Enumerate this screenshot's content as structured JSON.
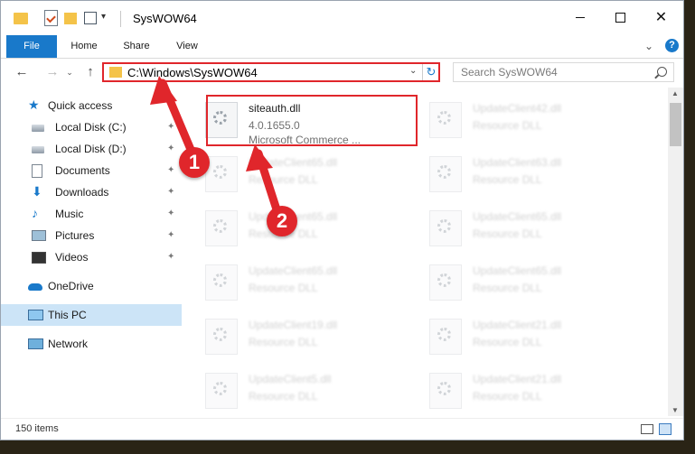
{
  "window": {
    "title": "SysWOW64",
    "controls": {
      "minimize": "—",
      "maximize": "☐",
      "close": "✕"
    }
  },
  "ribbon": {
    "tabs": [
      "File",
      "Home",
      "Share",
      "View"
    ],
    "help_label": "?",
    "chevron": "⌄"
  },
  "navigation": {
    "back": "←",
    "forward": "→",
    "recent": "⌄",
    "up": "↑",
    "address": "C:\\Windows\\SysWOW64",
    "refresh": "↻",
    "search_placeholder": "Search SysWOW64"
  },
  "sidebar": {
    "items": [
      {
        "label": "Quick access",
        "icon": "star-icon",
        "pinned": false
      },
      {
        "label": "Local Disk (C:)",
        "icon": "drive-icon",
        "pinned": true
      },
      {
        "label": "Local Disk (D:)",
        "icon": "drive-icon",
        "pinned": true
      },
      {
        "label": "Documents",
        "icon": "documents-icon",
        "pinned": true
      },
      {
        "label": "Downloads",
        "icon": "download-icon",
        "pinned": true
      },
      {
        "label": "Music",
        "icon": "music-icon",
        "pinned": true
      },
      {
        "label": "Pictures",
        "icon": "pictures-icon",
        "pinned": true
      },
      {
        "label": "Videos",
        "icon": "videos-icon",
        "pinned": true
      },
      {
        "label": "OneDrive",
        "icon": "cloud-icon",
        "pinned": false
      },
      {
        "label": "This PC",
        "icon": "pc-icon",
        "pinned": false,
        "selected": true
      },
      {
        "label": "Network",
        "icon": "network-icon",
        "pinned": false
      }
    ],
    "pin_glyph": "📌"
  },
  "files": [
    {
      "name": "siteauth.dll",
      "line2": "4.0.1655.0",
      "line3": "Microsoft Commerce ...",
      "highlighted": true
    },
    {
      "name": "UpdateClient42.dll",
      "line2": "Resource DLL",
      "blurred": true
    },
    {
      "name": "UpdateClient65.dll",
      "line2": "Resource DLL",
      "blurred": true
    },
    {
      "name": "UpdateClient63.dll",
      "line2": "Resource DLL",
      "blurred": true
    },
    {
      "name": "UpdateClient65.dll",
      "line2": "Resource DLL",
      "blurred": true
    },
    {
      "name": "UpdateClient65.dll",
      "line2": "Resource DLL",
      "blurred": true
    },
    {
      "name": "UpdateClient65.dll",
      "line2": "Resource DLL",
      "blurred": true
    },
    {
      "name": "UpdateClient65.dll",
      "line2": "Resource DLL",
      "blurred": true
    },
    {
      "name": "UpdateClient19.dll",
      "line2": "Resource DLL",
      "blurred": true
    },
    {
      "name": "UpdateClient21.dll",
      "line2": "Resource DLL",
      "blurred": true
    },
    {
      "name": "UpdateClient5.dll",
      "line2": "Resource DLL",
      "blurred": true
    },
    {
      "name": "UpdateClient21.dll",
      "line2": "Resource DLL",
      "blurred": true
    }
  ],
  "status": {
    "item_count": "150 items"
  },
  "annotations": {
    "badge1": "1",
    "badge2": "2",
    "color": "#e0262b"
  },
  "colors": {
    "accent": "#1979ca",
    "highlight": "#e0262b",
    "selection": "#cce4f7"
  }
}
